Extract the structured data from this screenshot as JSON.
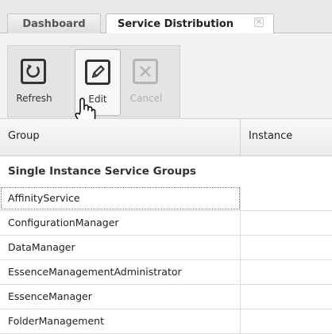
{
  "tabs": [
    {
      "label": "Dashboard"
    },
    {
      "label": "Service Distribution",
      "close": "×"
    }
  ],
  "toolbar": {
    "buttons": [
      {
        "label": "Refresh",
        "icon": "refresh-icon",
        "enabled": true
      },
      {
        "label": "Edit",
        "icon": "edit-icon",
        "enabled": true
      },
      {
        "label": "Cancel",
        "icon": "cancel-icon",
        "enabled": false
      }
    ]
  },
  "grid": {
    "columns": [
      "Group",
      "Instance"
    ],
    "group_title": "Single Instance Service Groups",
    "rows": [
      {
        "group": "AffinityService",
        "instance": ""
      },
      {
        "group": "ConfigurationManager",
        "instance": ""
      },
      {
        "group": "DataManager",
        "instance": ""
      },
      {
        "group": "EssenceManagementAdministrator",
        "instance": ""
      },
      {
        "group": "EssenceManager",
        "instance": ""
      },
      {
        "group": "FolderManagement",
        "instance": ""
      }
    ]
  }
}
